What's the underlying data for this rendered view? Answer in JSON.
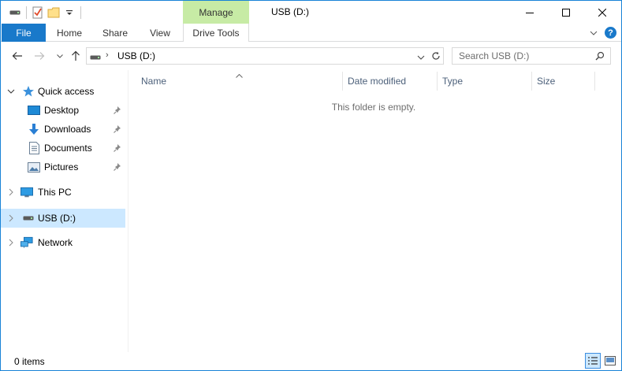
{
  "titlebar": {
    "title": "USB (D:)",
    "contextual_tab": "Manage",
    "accent": "#c7eba5"
  },
  "ribbon": {
    "tabs": [
      {
        "label": "File",
        "active": false,
        "color": "#1979ca"
      },
      {
        "label": "Home"
      },
      {
        "label": "Share"
      },
      {
        "label": "View"
      },
      {
        "label": "Drive Tools",
        "active": true
      }
    ],
    "help_label": "?"
  },
  "navbar": {
    "address": {
      "chevron": "›",
      "location": "USB (D:)"
    },
    "search_placeholder": "Search USB (D:)"
  },
  "navpane": {
    "items": [
      {
        "label": "Quick access",
        "icon": "star-icon",
        "expanded": true
      },
      {
        "label": "Desktop",
        "icon": "desktop-icon",
        "pinned": true
      },
      {
        "label": "Downloads",
        "icon": "download-icon",
        "pinned": true
      },
      {
        "label": "Documents",
        "icon": "document-icon",
        "pinned": true
      },
      {
        "label": "Pictures",
        "icon": "pictures-icon",
        "pinned": true
      },
      {
        "label": "This PC",
        "icon": "computer-icon",
        "expanded": false
      },
      {
        "label": "USB (D:)",
        "icon": "drive-icon",
        "selected": true,
        "expanded": false
      },
      {
        "label": "Network",
        "icon": "network-icon",
        "expanded": false
      }
    ]
  },
  "content": {
    "columns": [
      "Name",
      "Date modified",
      "Type",
      "Size"
    ],
    "empty_message": "This folder is empty."
  },
  "statusbar": {
    "item_count": "0 items"
  }
}
